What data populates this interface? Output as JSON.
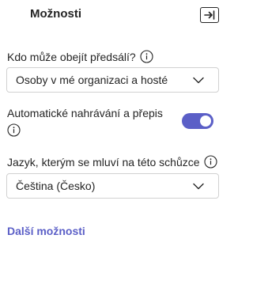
{
  "header": {
    "title": "Možnosti",
    "collapse_icon": "panel-collapse-icon"
  },
  "lobby": {
    "label": "Kdo může obejít předsálí?",
    "selected": "Osoby v mé organizaci a hosté"
  },
  "recording": {
    "label": "Automatické nahrávání a přepis",
    "toggle_on": true
  },
  "language": {
    "label": "Jazyk, kterým se mluví na této schůzce",
    "selected": "Čeština (Česko)"
  },
  "more_options": "Další možnosti",
  "colors": {
    "accent": "#5b5fc7",
    "text": "#242424",
    "border": "#d1d1d1"
  }
}
